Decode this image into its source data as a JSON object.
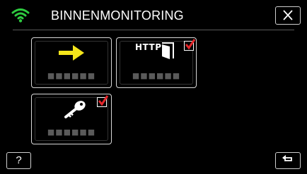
{
  "header": {
    "title": "BINNENMONITORING",
    "status_icon": "wifi-icon",
    "close_icon": "close-icon"
  },
  "tiles": [
    {
      "icon": "arrow-right-icon",
      "label": "■■■■■■",
      "checked": false
    },
    {
      "icon": "http-door-icon",
      "icon_text": "HTTP",
      "label": "■■■■■■",
      "checked": true
    },
    {
      "icon": "key-icon",
      "label": "■■■■■■",
      "checked": true
    }
  ],
  "footer": {
    "help_label": "?",
    "back_icon": "return-icon"
  },
  "colors": {
    "background": "#000000",
    "wifi": "#2ecc40",
    "arrow": "#f5e51b",
    "check": "#e4262a"
  }
}
